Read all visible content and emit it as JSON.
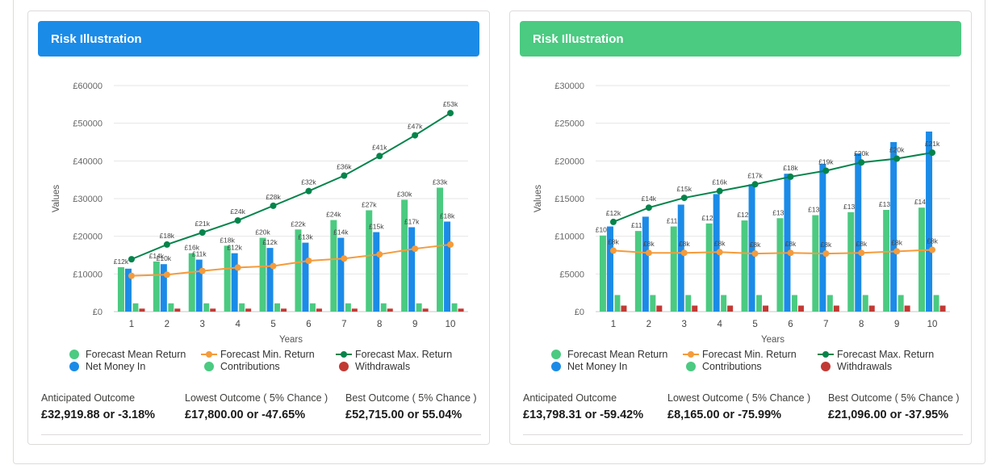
{
  "colors": {
    "header_left": "#1b8be8",
    "header_right": "#4bca81",
    "mean_bar": "#4bca81",
    "net_bar": "#1b8be8",
    "contrib_bar": "#4bca81",
    "withdraw_bar": "#c23934",
    "min_line": "#f59b3b",
    "max_line": "#04844b"
  },
  "legend": {
    "mean": "Forecast Mean Return",
    "min": "Forecast Min. Return",
    "max": "Forecast Max. Return",
    "net": "Net Money In",
    "contrib": "Contributions",
    "withdraw": "Withdrawals"
  },
  "cards": [
    {
      "title": "Risk Illustration",
      "outcomes": [
        {
          "label": "Anticipated Outcome",
          "value": "£32,919.88 or -3.18%"
        },
        {
          "label": "Lowest Outcome ( 5% Chance )",
          "value": "£17,800.00 or -47.65%"
        },
        {
          "label": "Best Outcome ( 5% Chance )",
          "value": "£52,715.00 or 55.04%"
        }
      ]
    },
    {
      "title": "Risk Illustration",
      "outcomes": [
        {
          "label": "Anticipated Outcome",
          "value": "£13,798.31 or -59.42%"
        },
        {
          "label": "Lowest Outcome ( 5% Chance )",
          "value": "£8,165.00 or -75.99%"
        },
        {
          "label": "Best Outcome ( 5% Chance )",
          "value": "£21,096.00 or -37.95%"
        }
      ]
    }
  ],
  "chart_data": [
    {
      "type": "bar",
      "xlabel": "Years",
      "ylabel": "Values",
      "ylim": [
        0,
        60000
      ],
      "yticks": [
        0,
        10000,
        20000,
        30000,
        40000,
        50000,
        60000
      ],
      "ytick_labels": [
        "£0",
        "£10000",
        "£20000",
        "£30000",
        "£40000",
        "£50000",
        "£60000"
      ],
      "categories": [
        "1",
        "2",
        "3",
        "4",
        "5",
        "6",
        "7",
        "8",
        "9",
        "10"
      ],
      "grid": true,
      "legend": "bottom",
      "series": [
        {
          "name": "Forecast Mean Return",
          "kind": "bar",
          "values": [
            11800,
            13300,
            15500,
            17500,
            19600,
            21800,
            24300,
            26900,
            29700,
            32900
          ]
        },
        {
          "name": "Net Money In",
          "kind": "bar",
          "values": [
            11400,
            12600,
            13800,
            15500,
            16900,
            18300,
            19600,
            21100,
            22400,
            23900
          ]
        },
        {
          "name": "Contributions",
          "kind": "bar",
          "values": [
            2200,
            2200,
            2200,
            2200,
            2200,
            2200,
            2200,
            2200,
            2200,
            2200
          ]
        },
        {
          "name": "Withdrawals",
          "kind": "bar",
          "values": [
            800,
            800,
            800,
            800,
            800,
            800,
            800,
            800,
            800,
            800
          ]
        },
        {
          "name": "Forecast Min. Return",
          "kind": "line",
          "values": [
            9500,
            9800,
            10800,
            11700,
            12100,
            13500,
            14100,
            15200,
            16700,
            17800
          ]
        },
        {
          "name": "Forecast Max. Return",
          "kind": "line",
          "values": [
            13900,
            17800,
            21000,
            24200,
            28100,
            32000,
            36100,
            41300,
            46800,
            52700
          ]
        }
      ],
      "data_labels": {
        "Forecast Mean Return": [
          "£12k",
          "£14k",
          "£16k",
          "£18k",
          "£20k",
          "£22k",
          "£24k",
          "£27k",
          "£30k",
          "£33k"
        ],
        "Net Money In": [
          "",
          "£10k",
          "£11k",
          "£12k",
          "£12k",
          "£13k",
          "£14k",
          "£15k",
          "£17k",
          "£18k"
        ],
        "Forecast Max. Return": [
          "",
          "£18k",
          "£21k",
          "£24k",
          "£28k",
          "£32k",
          "£36k",
          "£41k",
          "£47k",
          "£53k"
        ]
      }
    },
    {
      "type": "bar",
      "xlabel": "Years",
      "ylabel": "Values",
      "ylim": [
        0,
        30000
      ],
      "yticks": [
        0,
        5000,
        10000,
        15000,
        20000,
        25000,
        30000
      ],
      "ytick_labels": [
        "£0",
        "£5000",
        "£10000",
        "£15000",
        "£20000",
        "£25000",
        "£30000"
      ],
      "categories": [
        "1",
        "2",
        "3",
        "4",
        "5",
        "6",
        "7",
        "8",
        "9",
        "10"
      ],
      "grid": true,
      "legend": "bottom",
      "series": [
        {
          "name": "Forecast Mean Return",
          "kind": "bar",
          "values": [
            10100,
            10700,
            11300,
            11700,
            12100,
            12400,
            12800,
            13200,
            13500,
            13800
          ]
        },
        {
          "name": "Net Money In",
          "kind": "bar",
          "values": [
            11300,
            12600,
            14200,
            15600,
            16900,
            18300,
            19600,
            21000,
            22500,
            23900
          ]
        },
        {
          "name": "Contributions",
          "kind": "bar",
          "values": [
            2200,
            2200,
            2200,
            2200,
            2200,
            2200,
            2200,
            2200,
            2200,
            2200
          ]
        },
        {
          "name": "Withdrawals",
          "kind": "bar",
          "values": [
            800,
            800,
            800,
            800,
            800,
            800,
            800,
            800,
            800,
            800
          ]
        },
        {
          "name": "Forecast Min. Return",
          "kind": "line",
          "values": [
            8100,
            7800,
            7800,
            7900,
            7700,
            7800,
            7700,
            7800,
            8000,
            8200
          ]
        },
        {
          "name": "Forecast Max. Return",
          "kind": "line",
          "values": [
            11900,
            13800,
            15100,
            16000,
            16900,
            17900,
            18700,
            19800,
            20300,
            21100
          ]
        }
      ],
      "data_labels": {
        "Forecast Mean Return": [
          "£10k",
          "£11k",
          "£11k",
          "£12k",
          "£12k",
          "£13k",
          "£13k",
          "£13k",
          "£13k",
          "£14k"
        ],
        "Forecast Min. Return": [
          "£8k",
          "£8k",
          "£8k",
          "£8k",
          "£8k",
          "£8k",
          "£8k",
          "£8k",
          "£8k",
          "£8k"
        ],
        "Forecast Max. Return": [
          "£12k",
          "£14k",
          "£15k",
          "£16k",
          "£17k",
          "£18k",
          "£19k",
          "£20k",
          "£20k",
          "£21k"
        ]
      }
    }
  ]
}
